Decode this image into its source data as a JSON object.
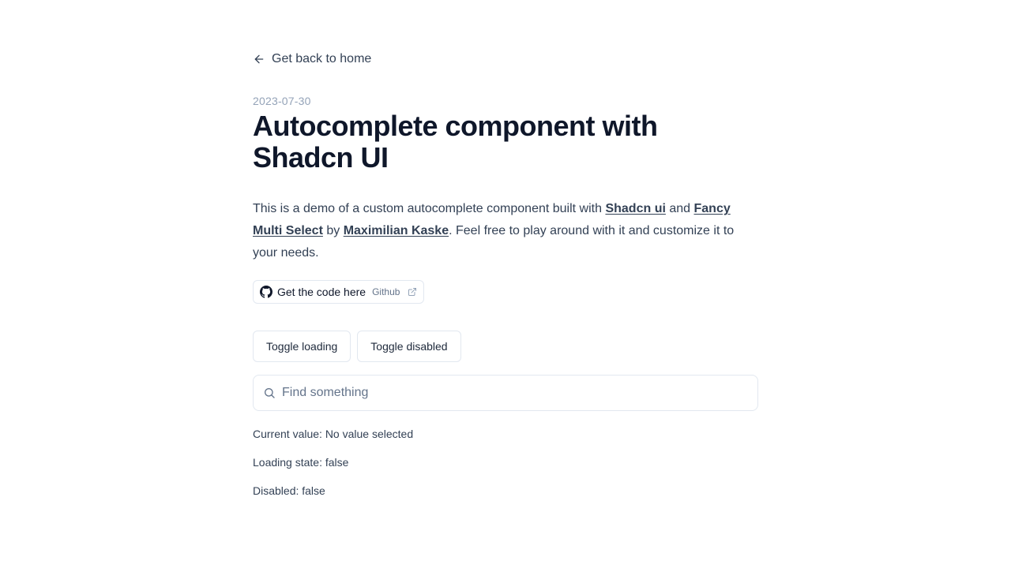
{
  "nav": {
    "back_label": "Get back to home"
  },
  "post": {
    "date": "2023-07-30",
    "title": "Autocomplete component with Shadcn UI",
    "desc_part1": "This is a demo of a custom autocomplete component built with ",
    "link_shadcn": "Shadcn ui",
    "desc_part2": " and ",
    "link_fancy": "Fancy Multi Select",
    "desc_part3": " by ",
    "link_author": "Maximilian Kaske",
    "desc_part4": ". Feel free to play around with it and customize it to your needs."
  },
  "code_button": {
    "label": "Get the code here",
    "sub": "Github"
  },
  "controls": {
    "toggle_loading": "Toggle loading",
    "toggle_disabled": "Toggle disabled"
  },
  "search": {
    "placeholder": "Find something",
    "value": ""
  },
  "state": {
    "current_value": "Current value: No value selected",
    "loading": "Loading state: false",
    "disabled": "Disabled: false"
  },
  "icons": {
    "back": "arrow-left-icon",
    "github": "github-icon",
    "external": "external-link-icon",
    "search": "search-icon"
  },
  "colors": {
    "title": "#0f172a",
    "date": "#94a3b8",
    "border": "#e2e8f0"
  }
}
